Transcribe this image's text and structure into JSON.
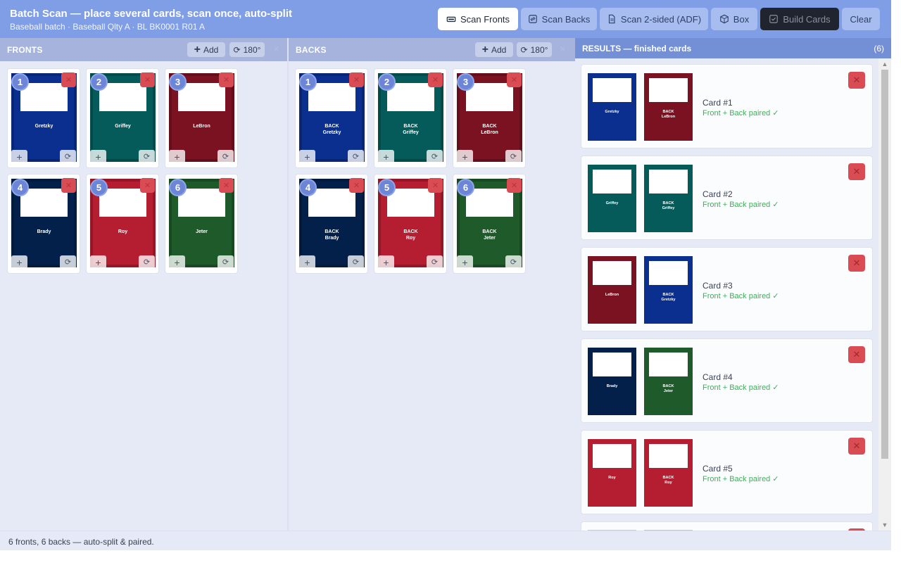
{
  "header": {
    "title": "Batch Scan — place several cards, scan once, auto-split",
    "subtitle": "Baseball batch · Baseball Qlty A · BL BK0001 R01 A"
  },
  "toolbar": {
    "scan_fronts": "Scan Fronts",
    "scan_backs": "Scan Backs",
    "scan_two_sided": "Scan 2-sided (ADF)",
    "box": "Box",
    "build_cards": "Build Cards",
    "clear": "Clear"
  },
  "fronts": {
    "title": "FRONTS",
    "add_label": "Add",
    "rotate_label": "180°",
    "cards": [
      {
        "num": "1",
        "name": "Gretzky",
        "color": "#0a2f8e"
      },
      {
        "num": "2",
        "name": "Griffey",
        "color": "#045b5a"
      },
      {
        "num": "3",
        "name": "LeBron",
        "color": "#7a1221"
      },
      {
        "num": "4",
        "name": "Brady",
        "color": "#03204a"
      },
      {
        "num": "5",
        "name": "Roy",
        "color": "#b51d30"
      },
      {
        "num": "6",
        "name": "Jeter",
        "color": "#1e5a2a"
      }
    ]
  },
  "backs": {
    "title": "BACKS",
    "add_label": "Add",
    "rotate_label": "180°",
    "cards": [
      {
        "num": "1",
        "label": "BACK",
        "name": "Gretzky",
        "color": "#0a2f8e"
      },
      {
        "num": "2",
        "label": "BACK",
        "name": "Griffey",
        "color": "#045b5a"
      },
      {
        "num": "3",
        "label": "BACK",
        "name": "LeBron",
        "color": "#7a1221"
      },
      {
        "num": "4",
        "label": "BACK",
        "name": "Brady",
        "color": "#03204a"
      },
      {
        "num": "5",
        "label": "BACK",
        "name": "Roy",
        "color": "#b51d30"
      },
      {
        "num": "6",
        "label": "BACK",
        "name": "Jeter",
        "color": "#1e5a2a"
      }
    ]
  },
  "results": {
    "title": "RESULTS — finished cards",
    "count": "(6)",
    "cards": [
      {
        "name": "Card #1",
        "status": "Front + Back paired ✓",
        "front": {
          "name": "Gretzky",
          "color": "#0a2f8e"
        },
        "back": {
          "label": "BACK",
          "name": "LeBron",
          "color": "#7a1221"
        }
      },
      {
        "name": "Card #2",
        "status": "Front + Back paired ✓",
        "front": {
          "name": "Griffey",
          "color": "#045b5a"
        },
        "back": {
          "label": "BACK",
          "name": "Griffey",
          "color": "#045b5a"
        }
      },
      {
        "name": "Card #3",
        "status": "Front + Back paired ✓",
        "front": {
          "name": "LeBron",
          "color": "#7a1221"
        },
        "back": {
          "label": "BACK",
          "name": "Gretzky",
          "color": "#0a2f8e"
        }
      },
      {
        "name": "Card #4",
        "status": "Front + Back paired ✓",
        "front": {
          "name": "Brady",
          "color": "#03204a"
        },
        "back": {
          "label": "BACK",
          "name": "Jeter",
          "color": "#1e5a2a"
        }
      },
      {
        "name": "Card #5",
        "status": "Front + Back paired ✓",
        "front": {
          "name": "Roy",
          "color": "#b51d30"
        },
        "back": {
          "label": "BACK",
          "name": "Roy",
          "color": "#b51d30"
        }
      }
    ]
  },
  "status_bar": {
    "text": "6 fronts, 6 backs — auto-split & paired."
  },
  "theme": {
    "header_bg": "#7f9ee5",
    "panel_header_bg": "#a6b4dd",
    "results_header_bg": "#7390d6",
    "danger": "#d94c53",
    "success": "#3fae5a"
  }
}
